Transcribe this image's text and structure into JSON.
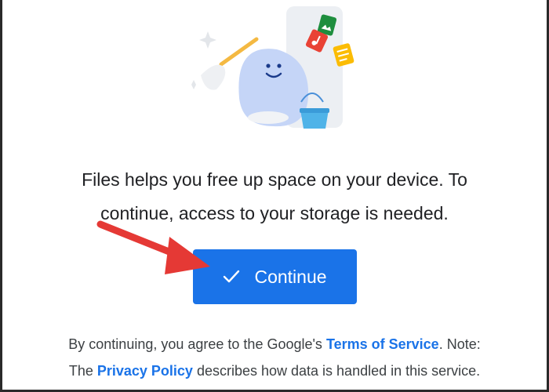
{
  "message": {
    "line1": "Files helps you free up space on your device. To",
    "line2": "continue, access to your storage is needed."
  },
  "continue_button": {
    "label": "Continue",
    "icon": "check-icon"
  },
  "legal": {
    "part1": "By continuing, you agree to the Google's ",
    "terms_link": "Terms of Service",
    "part2": ". Note:",
    "part3": "The ",
    "privacy_link": "Privacy Policy",
    "part4": " describes how data is handled in this service."
  },
  "colors": {
    "primary": "#1a73e8",
    "text": "#202124",
    "annotation_arrow": "#e53935",
    "mascot": "#c5d5f7"
  }
}
